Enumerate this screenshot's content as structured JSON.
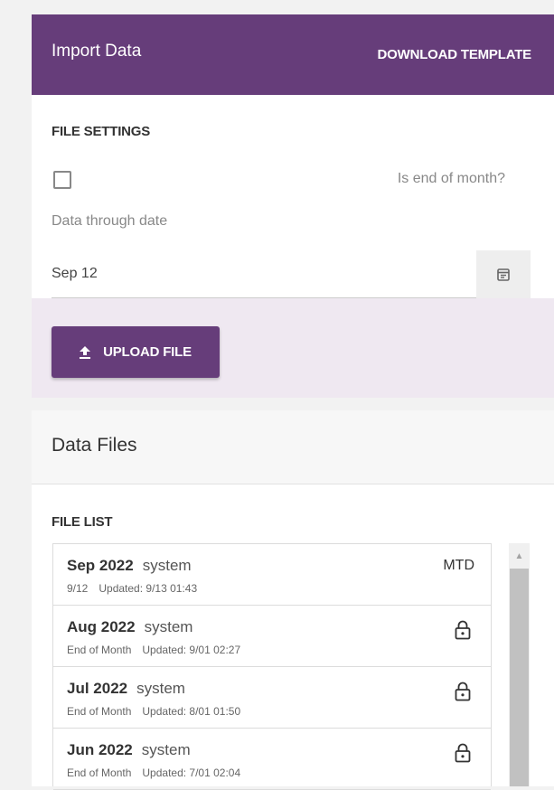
{
  "header": {
    "title": "Import Data",
    "download_label": "DOWNLOAD TEMPLATE"
  },
  "settings": {
    "heading": "FILE SETTINGS",
    "end_of_month_label": "Is end of month?",
    "end_of_month_checked": false,
    "data_through_label": "Data through date",
    "data_through_value": "Sep 12"
  },
  "upload": {
    "label": "UPLOAD FILE"
  },
  "files": {
    "title": "Data Files",
    "list_label": "FILE LIST",
    "rows": [
      {
        "month": "Sep 2022",
        "user": "system",
        "detail": "9/12",
        "updated": "Updated: 9/13 01:43",
        "status": "MTD",
        "locked": false
      },
      {
        "month": "Aug 2022",
        "user": "system",
        "detail": "End of Month",
        "updated": "Updated: 9/01 02:27",
        "status": "",
        "locked": true
      },
      {
        "month": "Jul 2022",
        "user": "system",
        "detail": "End of Month",
        "updated": "Updated: 8/01 01:50",
        "status": "",
        "locked": true
      },
      {
        "month": "Jun 2022",
        "user": "system",
        "detail": "End of Month",
        "updated": "Updated: 7/01 02:04",
        "status": "",
        "locked": true
      }
    ]
  },
  "colors": {
    "brand": "#663d7a",
    "upload_band": "#efe8f1"
  }
}
